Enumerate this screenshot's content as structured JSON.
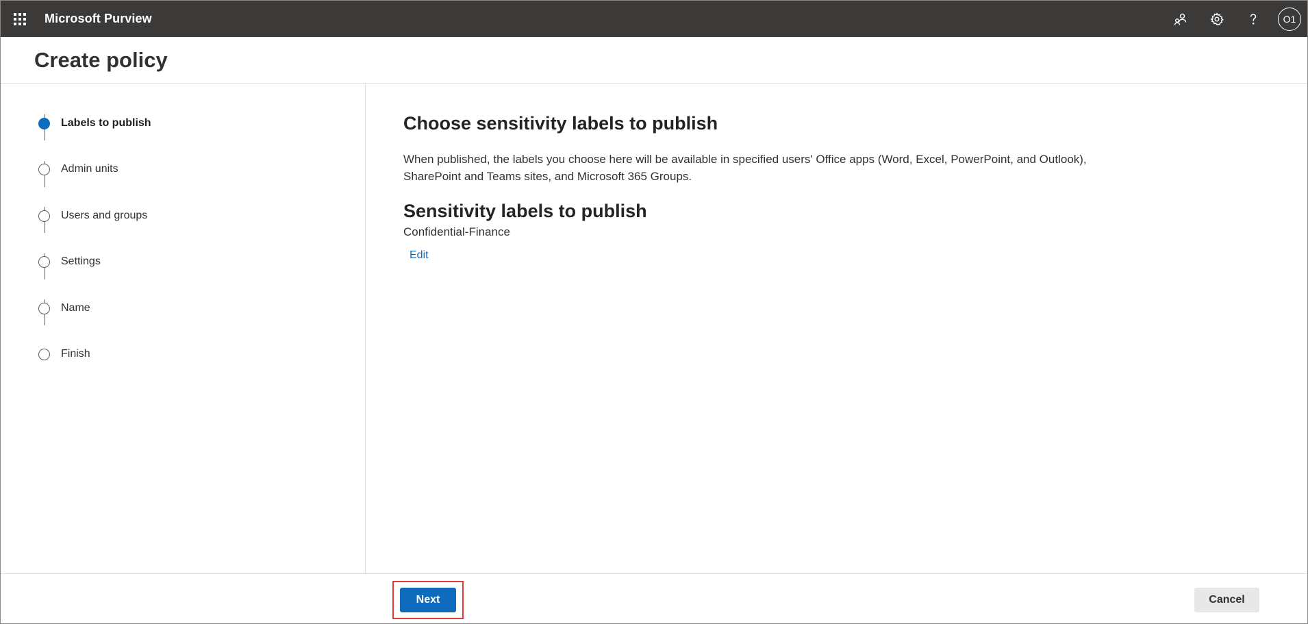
{
  "app": {
    "title": "Microsoft Purview",
    "avatar_initials": "O1",
    "accent_color": "#0f6cbd",
    "topbar_color": "#3b3a39",
    "icons": [
      "waffle-icon",
      "people-share-icon",
      "gear-icon",
      "help-icon"
    ]
  },
  "page": {
    "title": "Create policy"
  },
  "steps": [
    {
      "label": "Labels to publish",
      "state": "active"
    },
    {
      "label": "Admin units",
      "state": "pending"
    },
    {
      "label": "Users and groups",
      "state": "pending"
    },
    {
      "label": "Settings",
      "state": "pending"
    },
    {
      "label": "Name",
      "state": "pending"
    },
    {
      "label": "Finish",
      "state": "pending"
    }
  ],
  "main": {
    "heading": "Choose sensitivity labels to publish",
    "description": "When published, the labels you choose here will be available in specified users' Office apps (Word, Excel, PowerPoint, and Outlook), SharePoint and Teams sites, and Microsoft 365 Groups.",
    "subheading": "Sensitivity labels to publish",
    "selected_label": "Confidential-Finance",
    "edit_link": "Edit"
  },
  "footer": {
    "next_label": "Next",
    "cancel_label": "Cancel"
  }
}
